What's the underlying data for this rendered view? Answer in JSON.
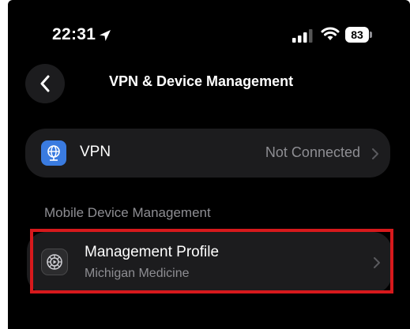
{
  "status_bar": {
    "time": "22:31",
    "battery": "83"
  },
  "header": {
    "title": "VPN & Device Management"
  },
  "vpn": {
    "label": "VPN",
    "status": "Not Connected"
  },
  "mdm": {
    "section_label": "Mobile Device Management",
    "profile_title": "Management Profile",
    "profile_subtitle": "Michigan Medicine"
  },
  "icons": {
    "location": "location-arrow-icon",
    "signal": "cellular-signal-icon",
    "wifi": "wifi-icon",
    "back": "chevron-left-icon",
    "vpn": "globe-icon",
    "profile": "gear-icon",
    "disclosure": "chevron-right-icon"
  },
  "colors": {
    "background": "#000000",
    "row_background": "#1c1c1e",
    "secondary_text": "#8e8e93",
    "vpn_icon": "#3a7be0",
    "highlight_border": "#d7191c"
  }
}
